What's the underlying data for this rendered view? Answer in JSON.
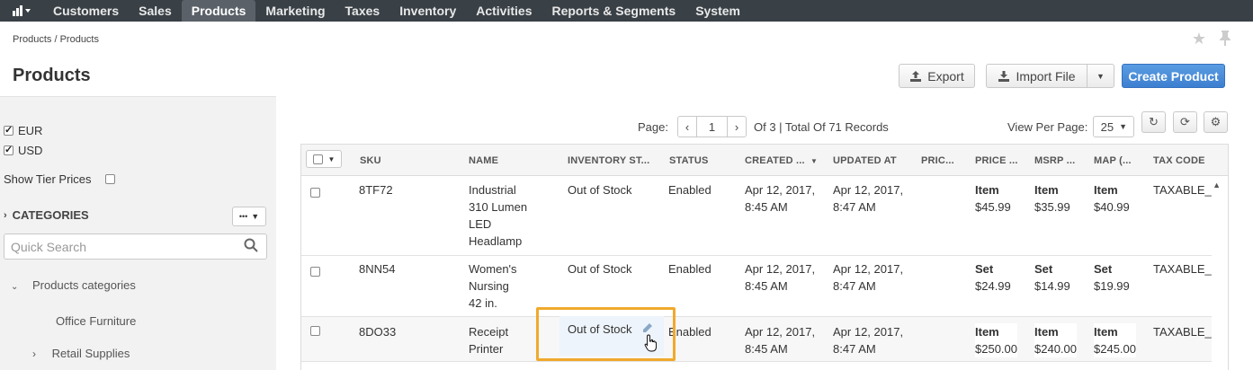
{
  "nav": {
    "items": [
      "Customers",
      "Sales",
      "Products",
      "Marketing",
      "Taxes",
      "Inventory",
      "Activities",
      "Reports & Segments",
      "System"
    ],
    "active": "Products"
  },
  "breadcrumb": "Products / Products",
  "page_title": "Products",
  "buttons": {
    "export": "Export",
    "import": "Import File",
    "create": "Create Product"
  },
  "sidebar": {
    "currencies": [
      {
        "label": "EUR",
        "checked": true
      },
      {
        "label": "USD",
        "checked": true
      }
    ],
    "show_tier_prices": "Show Tier Prices",
    "categories_label": "CATEGORIES",
    "quick_search_placeholder": "Quick Search",
    "tree": [
      "Products categories",
      "Office Furniture",
      "Retail Supplies"
    ]
  },
  "pager": {
    "page_label": "Page:",
    "current_page": "1",
    "summary": "Of 3 | Total Of 71 Records",
    "view_per_page_label": "View Per Page:",
    "per_page": "25"
  },
  "grid": {
    "columns": [
      "SKU",
      "NAME",
      "INVENTORY ST...",
      "STATUS",
      "CREATED ...",
      "UPDATED AT",
      "PRIC...",
      "PRICE ...",
      "MSRP ...",
      "MAP (...",
      "TAX CODE"
    ],
    "rows": [
      {
        "sku": "8TF72",
        "name": [
          "Industrial",
          "310 Lumen",
          "LED",
          "Headlamp"
        ],
        "inventory": "Out of Stock",
        "status": "Enabled",
        "created": [
          "Apr 12, 2017,",
          "8:45 AM"
        ],
        "updated": [
          "Apr 12, 2017,",
          "8:47 AM"
        ],
        "price": [
          "Item",
          "$45.99"
        ],
        "msrp": [
          "Item",
          "$35.99"
        ],
        "map": [
          "Item",
          "$40.99"
        ],
        "tax": "TAXABLE_"
      },
      {
        "sku": "8NN54",
        "name": [
          "Women's",
          "Nursing",
          "42 in."
        ],
        "inventory": "Out of Stock",
        "status": "Enabled",
        "created": [
          "Apr 12, 2017,",
          "8:45 AM"
        ],
        "updated": [
          "Apr 12, 2017,",
          "8:47 AM"
        ],
        "price": [
          "Set",
          "$24.99"
        ],
        "msrp": [
          "Set",
          "$14.99"
        ],
        "map": [
          "Set",
          "$19.99"
        ],
        "tax": "TAXABLE_"
      },
      {
        "sku": "8DO33",
        "name": [
          "Receipt",
          "Printer"
        ],
        "inventory": "Out of Stock",
        "status": "Enabled",
        "created": [
          "Apr 12, 2017,",
          "8:45 AM"
        ],
        "updated": [
          "Apr 12, 2017,",
          "8:47 AM"
        ],
        "price": [
          "Item",
          "$250.00"
        ],
        "msrp": [
          "Item",
          "$240.00"
        ],
        "map": [
          "Item",
          "$245.00"
        ],
        "tax": "TAXABLE_"
      }
    ]
  },
  "colors": {
    "nav_bg": "#394046",
    "primary_button": "#4a8ad9",
    "highlight_border": "#f0a92c"
  }
}
